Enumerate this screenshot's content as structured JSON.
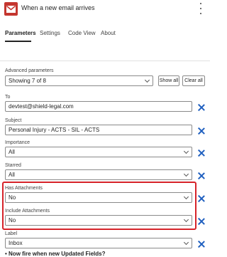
{
  "header": {
    "title": "When a new email arrives",
    "brand_color": "#c4362f"
  },
  "tabs": [
    {
      "label": "Parameters",
      "active": true
    },
    {
      "label": "Settings",
      "active": false
    },
    {
      "label": "Code View",
      "active": false
    },
    {
      "label": "About",
      "active": false
    }
  ],
  "advanced": {
    "label": "Advanced parameters",
    "value": "Showing 7 of 8",
    "show_all": "Show all",
    "clear_all": "Clear all"
  },
  "fields": {
    "to": {
      "label": "To",
      "value": "devtest@shield-legal.com"
    },
    "subject": {
      "label": "Subject",
      "value": "Personal Injury - ACTS - SIL - ACTS"
    },
    "importance": {
      "label": "Importance",
      "value": "All"
    },
    "starred": {
      "label": "Starred",
      "value": "All"
    },
    "has_attachments": {
      "label": "Has Attachments",
      "value": "No"
    },
    "include_attachments": {
      "label": "Include Attachments",
      "value": "No"
    },
    "label": {
      "label": "Label",
      "value": "Inbox"
    }
  },
  "bottom_text": "• Now fire when new Updated Fields?",
  "highlight_color": "#d6232a",
  "remove_icon_color": "#1f5fbf"
}
